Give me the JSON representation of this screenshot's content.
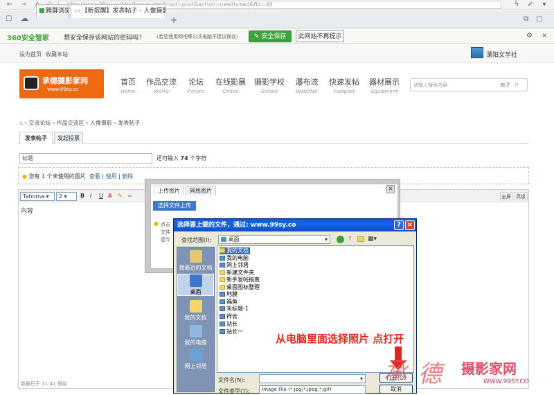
{
  "browser": {
    "url": "http://www.99sy.co/bbs/forum.php?mod=post&action=newthread&fid=46",
    "tabs": [
      {
        "label": "跨屏浏览"
      },
      {
        "label": "【新提醒】发表帖子 - 人像摄影"
      }
    ],
    "new_tab": "+"
  },
  "password_bar": {
    "brand": "360安全管家",
    "question": "想安全保存该网站的密码吗？",
    "note": "（若您使用网吧等公共电脑不建议保存）",
    "save_button": "安全保存",
    "never_button": "此网站不再提示"
  },
  "site": {
    "top_links": [
      "设为首页",
      "收藏本站"
    ],
    "partner": "溧阳文学社",
    "logo_cn": "承德摄影家网",
    "logo_url": "www.99sy.co",
    "nav": [
      {
        "cn": "首页",
        "en": "-Home-"
      },
      {
        "cn": "作品交流",
        "en": "-Works-"
      },
      {
        "cn": "论坛",
        "en": "-Forum-"
      },
      {
        "cn": "在线影展",
        "en": "-Online-"
      },
      {
        "cn": "摄影学校",
        "en": "-School-"
      },
      {
        "cn": "瀑布流",
        "en": "-Waterfall-"
      },
      {
        "cn": "快速发帖",
        "en": "-Fastpost-"
      },
      {
        "cn": "器材展示",
        "en": "-Equipment-"
      }
    ],
    "search_placeholder": "请输入搜索内容",
    "search_scope": "帖子",
    "breadcrumbs": [
      "交流论坛",
      "作品交流区",
      "人像摄影",
      "发表帖子"
    ],
    "post_tabs": [
      "发表帖子",
      "发起投票"
    ],
    "title_placeholder": "标题",
    "chars_left_prefix": "还可输入",
    "chars_left": "74",
    "chars_left_suffix": "个字符",
    "unused_prefix": "您有",
    "unused_count": "1",
    "unused_suffix": "个未使用的图片",
    "unused_view": "查看",
    "unused_use": "使用",
    "unused_delete": "删除",
    "font_name": "Tahoma",
    "font_size": "2",
    "fullscreen": "全屏",
    "advanced": "高级",
    "content_placeholder": "内容",
    "saved_status": "数据已于 11:41 保存"
  },
  "upload_modal": {
    "tabs": [
      "上传图片",
      "网络图片"
    ],
    "select_button": "选择文件上传",
    "tip_lines": [
      "点击",
      "文件",
      "您今"
    ]
  },
  "file_dialog": {
    "title": "选择要上载的文件，通过: www.99sy.co",
    "lookin_label": "查找范围(I):",
    "lookin_value": "桌面",
    "places": [
      "我最近的文档",
      "桌面",
      "我的文档",
      "我的电脑",
      "网上邻居"
    ],
    "files": [
      {
        "name": "我的文档",
        "kind": "folder"
      },
      {
        "name": "我的电脑",
        "kind": "folder"
      },
      {
        "name": "网上邻居",
        "kind": "folder"
      },
      {
        "name": "新建文件夹",
        "kind": "folder"
      },
      {
        "name": "新手发帖指南",
        "kind": "folder"
      },
      {
        "name": "桌面图标整理",
        "kind": "folder"
      },
      {
        "name": "地膜",
        "kind": "image"
      },
      {
        "name": "福鱼",
        "kind": "image"
      },
      {
        "name": "未标题-1",
        "kind": "image"
      },
      {
        "name": "祥云",
        "kind": "image"
      },
      {
        "name": "站长",
        "kind": "image"
      },
      {
        "name": "站长一",
        "kind": "image"
      }
    ],
    "filename_label": "文件名(N):",
    "filetype_label": "文件类型(T):",
    "filetype_value": "Image File (*.jpg;*.jpeg;*.gif)",
    "open_button": "打开(O)",
    "cancel_button": "取消"
  },
  "annotation": "从电脑里面选择照片 点打开",
  "watermark": {
    "char_cheng": "承",
    "char_de": "德",
    "site": "摄影家网",
    "url": "WWW.99SY.CO"
  },
  "colors": {
    "accent_green": "#3da33d",
    "logo_orange": "#ee6a12",
    "annotation_red": "#e3261d",
    "xp_blue": "#0a59d8"
  }
}
